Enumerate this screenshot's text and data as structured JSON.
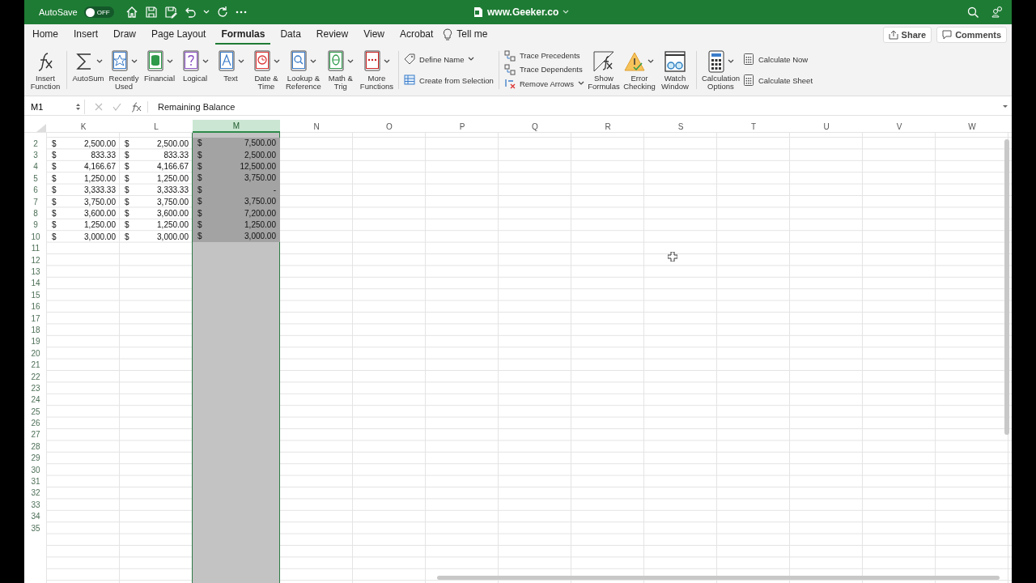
{
  "title_bar": {
    "autosave_label": "AutoSave",
    "autosave_toggle": {
      "on": false,
      "label": "OFF"
    },
    "title": "www.Geeker.co"
  },
  "menu_tabs": [
    {
      "label": "Home",
      "selected": false
    },
    {
      "label": "Insert",
      "selected": false
    },
    {
      "label": "Draw",
      "selected": false
    },
    {
      "label": "Page Layout",
      "selected": false
    },
    {
      "label": "Formulas",
      "selected": true
    },
    {
      "label": "Data",
      "selected": false
    },
    {
      "label": "Review",
      "selected": false
    },
    {
      "label": "View",
      "selected": false
    },
    {
      "label": "Acrobat",
      "selected": false
    }
  ],
  "tell_me": "Tell me",
  "share_button": "Share",
  "comments_button": "Comments",
  "ribbon": {
    "groups": [
      {
        "items": [
          {
            "kind": "large",
            "lines": [
              "Insert",
              "Function"
            ],
            "dropdown": false
          }
        ]
      },
      {
        "items": [
          {
            "kind": "large",
            "lines": [
              "AutoSum"
            ],
            "dropdown": true
          },
          {
            "kind": "large",
            "lines": [
              "Recently",
              "Used"
            ],
            "dropdown": true
          },
          {
            "kind": "large",
            "lines": [
              "Financial"
            ],
            "dropdown": true
          },
          {
            "kind": "large",
            "lines": [
              "Logical"
            ],
            "dropdown": true
          },
          {
            "kind": "large",
            "lines": [
              "Text"
            ],
            "dropdown": true
          },
          {
            "kind": "large",
            "lines": [
              "Date &",
              "Time"
            ],
            "dropdown": true
          },
          {
            "kind": "large",
            "lines": [
              "Lookup &",
              "Reference"
            ],
            "dropdown": true
          },
          {
            "kind": "large",
            "lines": [
              "Math &",
              "Trig"
            ],
            "dropdown": true
          },
          {
            "kind": "large",
            "lines": [
              "More",
              "Functions"
            ],
            "dropdown": true
          }
        ]
      },
      {
        "items": [
          {
            "kind": "stack",
            "items": [
              {
                "label": "Define Name",
                "dropdown": true
              },
              {
                "label": "Create from Selection",
                "dropdown": false
              }
            ]
          }
        ]
      },
      {
        "items": [
          {
            "kind": "stack",
            "items": [
              {
                "label": "Trace Precedents",
                "dropdown": false
              },
              {
                "label": "Trace Dependents",
                "dropdown": false
              },
              {
                "label": "Remove Arrows",
                "dropdown": true
              }
            ]
          },
          {
            "kind": "large",
            "lines": [
              "Show",
              "Formulas"
            ],
            "dropdown": false
          },
          {
            "kind": "large",
            "lines": [
              "Error",
              "Checking"
            ],
            "dropdown": true
          },
          {
            "kind": "large",
            "lines": [
              "Watch",
              "Window"
            ],
            "dropdown": false
          }
        ]
      },
      {
        "items": [
          {
            "kind": "large",
            "lines": [
              "Calculation",
              "Options"
            ],
            "dropdown": true
          },
          {
            "kind": "stack",
            "items": [
              {
                "label": "Calculate Now",
                "dropdown": false
              },
              {
                "label": "Calculate Sheet",
                "dropdown": false
              }
            ]
          }
        ]
      }
    ]
  },
  "formula_bar": {
    "name_box": "M1",
    "formula": "Remaining Balance"
  },
  "sheet": {
    "columns": [
      {
        "label": "K",
        "selected": false
      },
      {
        "label": "L",
        "selected": false
      },
      {
        "label": "M",
        "selected": true
      },
      {
        "label": "N",
        "selected": false
      },
      {
        "label": "O",
        "selected": false
      },
      {
        "label": "P",
        "selected": false
      },
      {
        "label": "Q",
        "selected": false
      },
      {
        "label": "R",
        "selected": false
      },
      {
        "label": "S",
        "selected": false
      },
      {
        "label": "T",
        "selected": false
      },
      {
        "label": "U",
        "selected": false
      },
      {
        "label": "V",
        "selected": false
      },
      {
        "label": "W",
        "selected": false
      }
    ],
    "rows": [
      {
        "number": "2",
        "cells": [
          {
            "currency": "$",
            "value": "2,500.00"
          },
          {
            "currency": "$",
            "value": "2,500.00"
          },
          {
            "currency": "$",
            "value": "7,500.00"
          }
        ]
      },
      {
        "number": "3",
        "cells": [
          {
            "currency": "$",
            "value": "833.33"
          },
          {
            "currency": "$",
            "value": "833.33"
          },
          {
            "currency": "$",
            "value": "2,500.00"
          }
        ]
      },
      {
        "number": "4",
        "cells": [
          {
            "currency": "$",
            "value": "4,166.67"
          },
          {
            "currency": "$",
            "value": "4,166.67"
          },
          {
            "currency": "$",
            "value": "12,500.00"
          }
        ]
      },
      {
        "number": "5",
        "cells": [
          {
            "currency": "$",
            "value": "1,250.00"
          },
          {
            "currency": "$",
            "value": "1,250.00"
          },
          {
            "currency": "$",
            "value": "3,750.00"
          }
        ]
      },
      {
        "number": "6",
        "cells": [
          {
            "currency": "$",
            "value": "3,333.33"
          },
          {
            "currency": "$",
            "value": "3,333.33"
          },
          {
            "currency": "$",
            "value": "-"
          }
        ]
      },
      {
        "number": "7",
        "cells": [
          {
            "currency": "$",
            "value": "3,750.00"
          },
          {
            "currency": "$",
            "value": "3,750.00"
          },
          {
            "currency": "$",
            "value": "3,750.00"
          }
        ]
      },
      {
        "number": "8",
        "cells": [
          {
            "currency": "$",
            "value": "3,600.00"
          },
          {
            "currency": "$",
            "value": "3,600.00"
          },
          {
            "currency": "$",
            "value": "7,200.00"
          }
        ]
      },
      {
        "number": "9",
        "cells": [
          {
            "currency": "$",
            "value": "1,250.00"
          },
          {
            "currency": "$",
            "value": "1,250.00"
          },
          {
            "currency": "$",
            "value": "1,250.00"
          }
        ]
      },
      {
        "number": "10",
        "cells": [
          {
            "currency": "$",
            "value": "3,000.00"
          },
          {
            "currency": "$",
            "value": "3,000.00"
          },
          {
            "currency": "$",
            "value": "3,000.00"
          }
        ]
      },
      {
        "number": "11"
      },
      {
        "number": "12"
      },
      {
        "number": "13"
      },
      {
        "number": "14"
      },
      {
        "number": "15"
      },
      {
        "number": "16"
      },
      {
        "number": "17"
      },
      {
        "number": "18"
      },
      {
        "number": "19"
      },
      {
        "number": "20"
      },
      {
        "number": "21"
      },
      {
        "number": "22"
      },
      {
        "number": "23"
      },
      {
        "number": "24"
      },
      {
        "number": "25"
      },
      {
        "number": "26"
      },
      {
        "number": "27"
      },
      {
        "number": "28"
      },
      {
        "number": "29"
      },
      {
        "number": "30"
      },
      {
        "number": "31"
      },
      {
        "number": "32"
      },
      {
        "number": "33"
      },
      {
        "number": "34"
      },
      {
        "number": "35"
      }
    ]
  }
}
